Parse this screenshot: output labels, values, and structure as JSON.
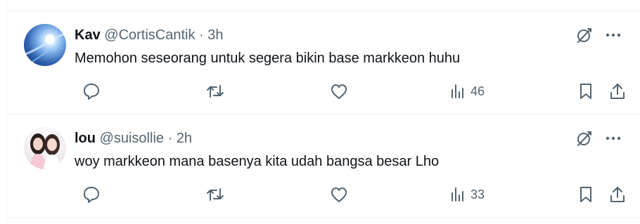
{
  "tweets": [
    {
      "name": "Kav",
      "handle": "@CortisCantik",
      "separator": "·",
      "time": "3h",
      "text": "Memohon seseorang untuk segera bikin base markkeon huhu",
      "views": "46"
    },
    {
      "name": "lou",
      "handle": "@suisollie",
      "separator": "·",
      "time": "2h",
      "text": "woy markkeon mana basenya kita udah bangsa besar Lho",
      "views": "33"
    }
  ],
  "icons": {
    "reply": "reply-icon",
    "retweet": "retweet-icon",
    "like": "like-icon",
    "views": "views-icon",
    "bookmark": "bookmark-icon",
    "share": "share-icon",
    "grok": "grok-icon",
    "more": "more-icon"
  },
  "colors": {
    "icon": "#536471",
    "text": "#0f1419",
    "divider": "#eff3f4"
  }
}
